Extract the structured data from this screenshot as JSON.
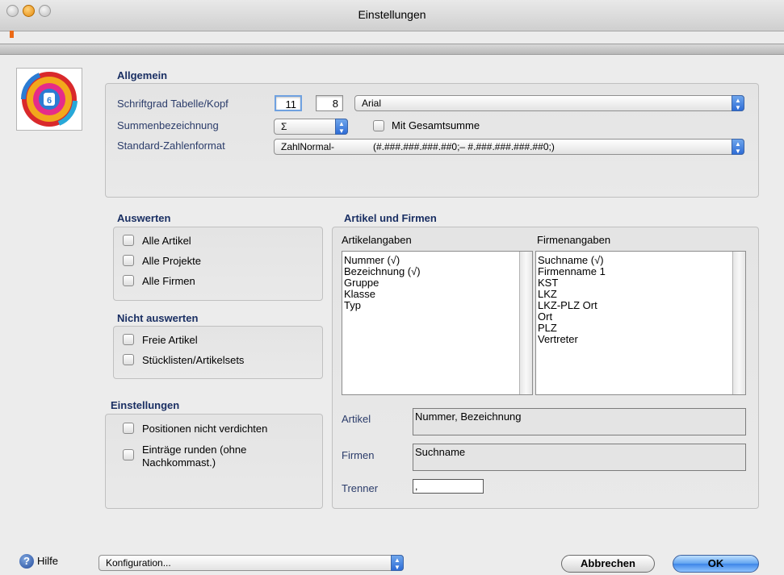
{
  "window": {
    "title": "Einstellungen"
  },
  "allgemein": {
    "title": "Allgemein",
    "schriftgrad_label": "Schriftgrad Tabelle/Kopf",
    "size_table": "11",
    "size_head": "8",
    "font": "Arial",
    "summen_label": "Summenbezeichnung",
    "summen_value": "Σ",
    "gesamtsumme_label": "Mit Gesamtsumme",
    "zahlenformat_label": "Standard-Zahlenformat",
    "zahlenformat_name": "ZahlNormal-",
    "zahlenformat_pattern": "(#.###.###.###.##0;– #.###.###.###.##0;)"
  },
  "auswerten": {
    "title": "Auswerten",
    "items": [
      "Alle Artikel",
      "Alle Projekte",
      "Alle Firmen"
    ]
  },
  "nicht_auswerten": {
    "title": "Nicht auswerten",
    "items": [
      "Freie Artikel",
      "Stücklisten/Artikelsets"
    ]
  },
  "einstellungen": {
    "title": "Einstellungen",
    "item1": "Positionen nicht verdichten",
    "item2_line1": "Einträge runden (ohne",
    "item2_line2": "Nachkommast.)"
  },
  "artikel_firmen": {
    "title": "Artikel und Firmen",
    "artikel_header": "Artikelangaben",
    "firmen_header": "Firmenangaben",
    "artikel_list": [
      "Nummer (√)",
      "Bezeichnung (√)",
      "Gruppe",
      "Klasse",
      "Typ"
    ],
    "firmen_list": [
      "Suchname (√)",
      "Firmenname 1",
      "KST",
      "LKZ",
      "LKZ-PLZ Ort",
      "Ort",
      "PLZ",
      "Vertreter"
    ],
    "artikel_label": "Artikel",
    "artikel_value": "Nummer, Bezeichnung",
    "firmen_label": "Firmen",
    "firmen_value": "Suchname",
    "trenner_label": "Trenner",
    "trenner_value": ","
  },
  "footer": {
    "help_label": "Hilfe",
    "config_value": "Konfiguration...",
    "cancel_label": "Abbrechen",
    "ok_label": "OK"
  }
}
